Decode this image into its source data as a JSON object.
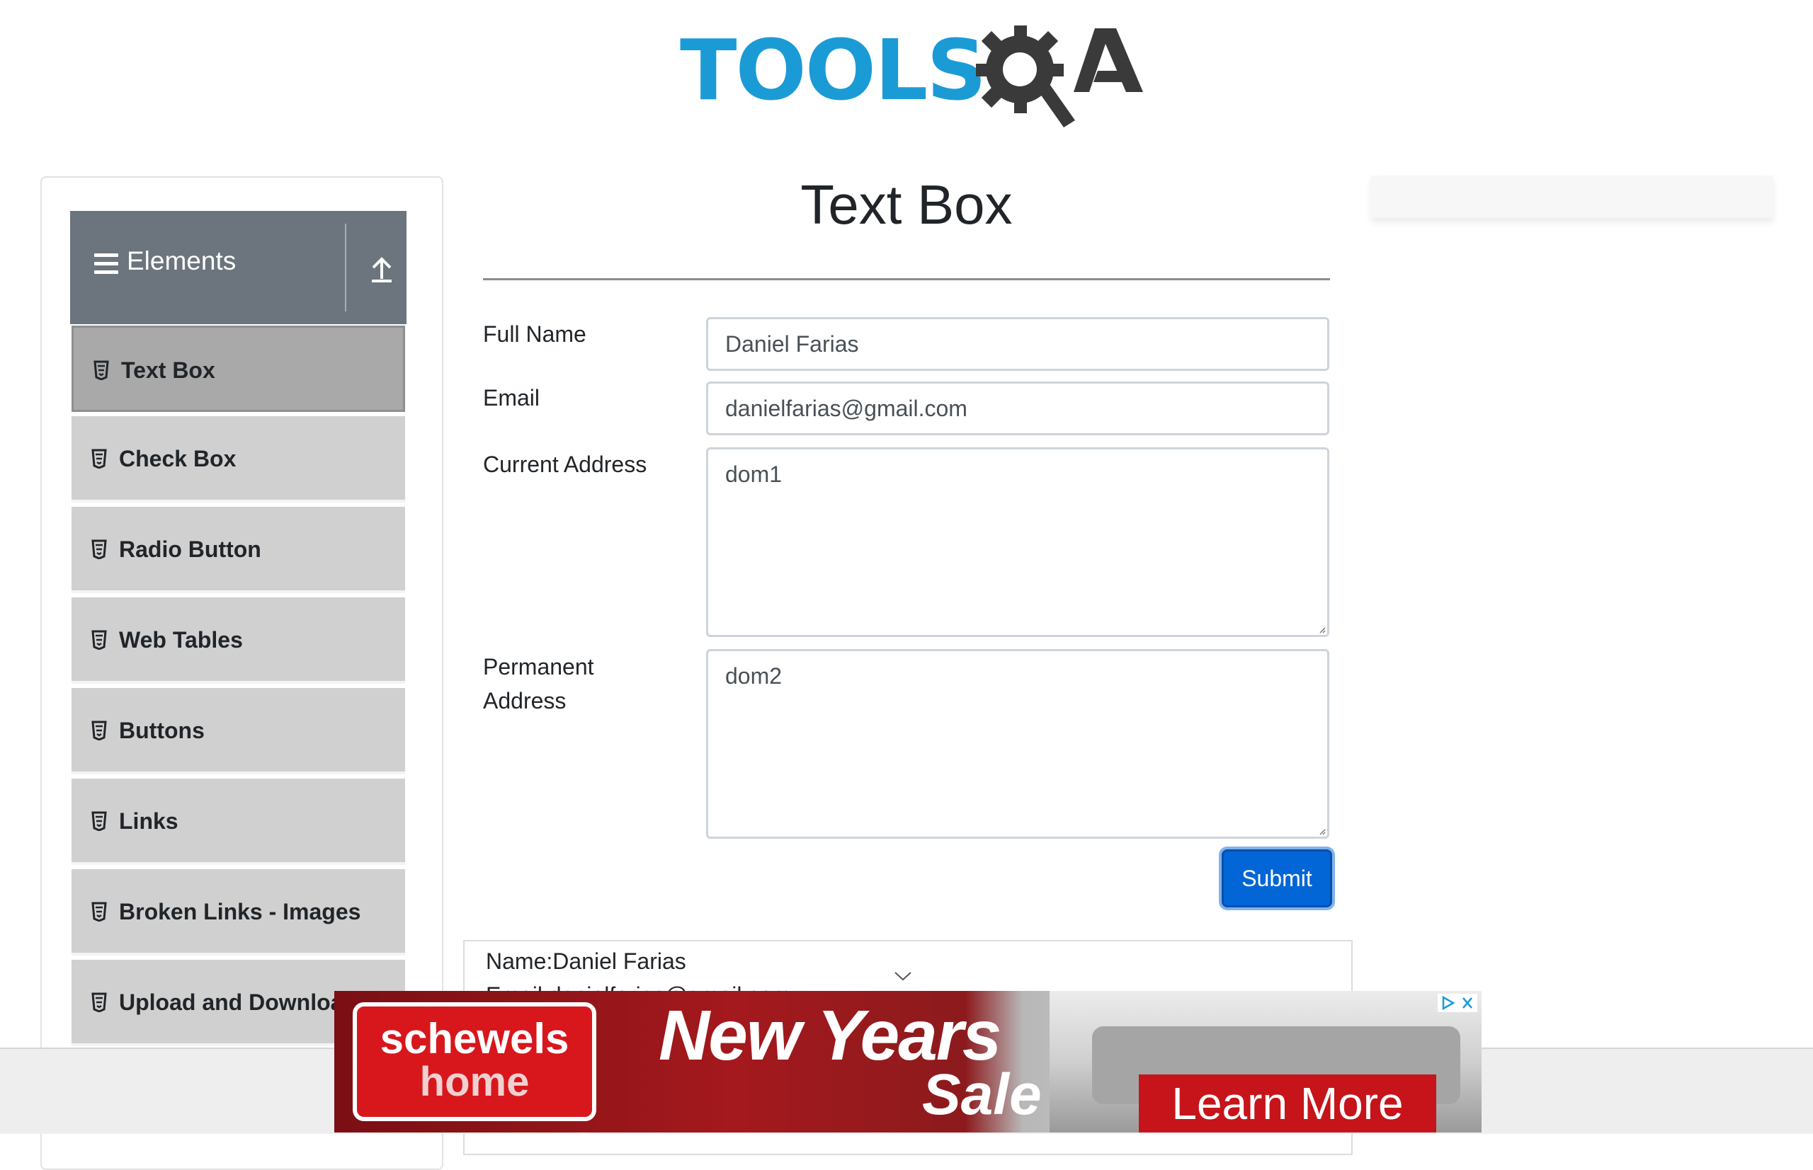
{
  "header": {
    "logo_text": "TOOLS",
    "logo_suffix": "QA",
    "colors": {
      "brand_blue": "#1b9bd6",
      "brand_dark": "#3a3a3a"
    }
  },
  "sidebar": {
    "group_title": "Elements",
    "group_icon": "hamburger-icon",
    "collapse_icon": "collapse-up-icon",
    "items": [
      {
        "label": "Text Box",
        "icon": "html5-icon",
        "active": true
      },
      {
        "label": "Check Box",
        "icon": "html5-icon",
        "active": false
      },
      {
        "label": "Radio Button",
        "icon": "html5-icon",
        "active": false
      },
      {
        "label": "Web Tables",
        "icon": "html5-icon",
        "active": false
      },
      {
        "label": "Buttons",
        "icon": "html5-icon",
        "active": false
      },
      {
        "label": "Links",
        "icon": "html5-icon",
        "active": false
      },
      {
        "label": "Broken Links - Images",
        "icon": "html5-icon",
        "active": false
      },
      {
        "label": "Upload and Download",
        "icon": "html5-icon",
        "active": false
      }
    ]
  },
  "main": {
    "title": "Text Box",
    "form": {
      "full_name_label": "Full Name",
      "full_name_value": "Daniel Farias",
      "email_label": "Email",
      "email_value": "danielfarias@gmail.com",
      "current_address_label": "Current Address",
      "current_address_value": "dom1",
      "permanent_address_label": "Permanent Address",
      "permanent_address_value": "dom2",
      "submit_label": "Submit"
    },
    "output": {
      "name_line": "Name:Daniel Farias",
      "email_line": "Email:danielfarias@gmail.com"
    }
  },
  "ad": {
    "brand_line1": "schewels",
    "brand_line2": "home",
    "headline": "New Years",
    "subheadline": "Sale",
    "cta": "Learn More",
    "colors": {
      "brand_red": "#d8171d",
      "cta_red": "#c6141a"
    }
  }
}
